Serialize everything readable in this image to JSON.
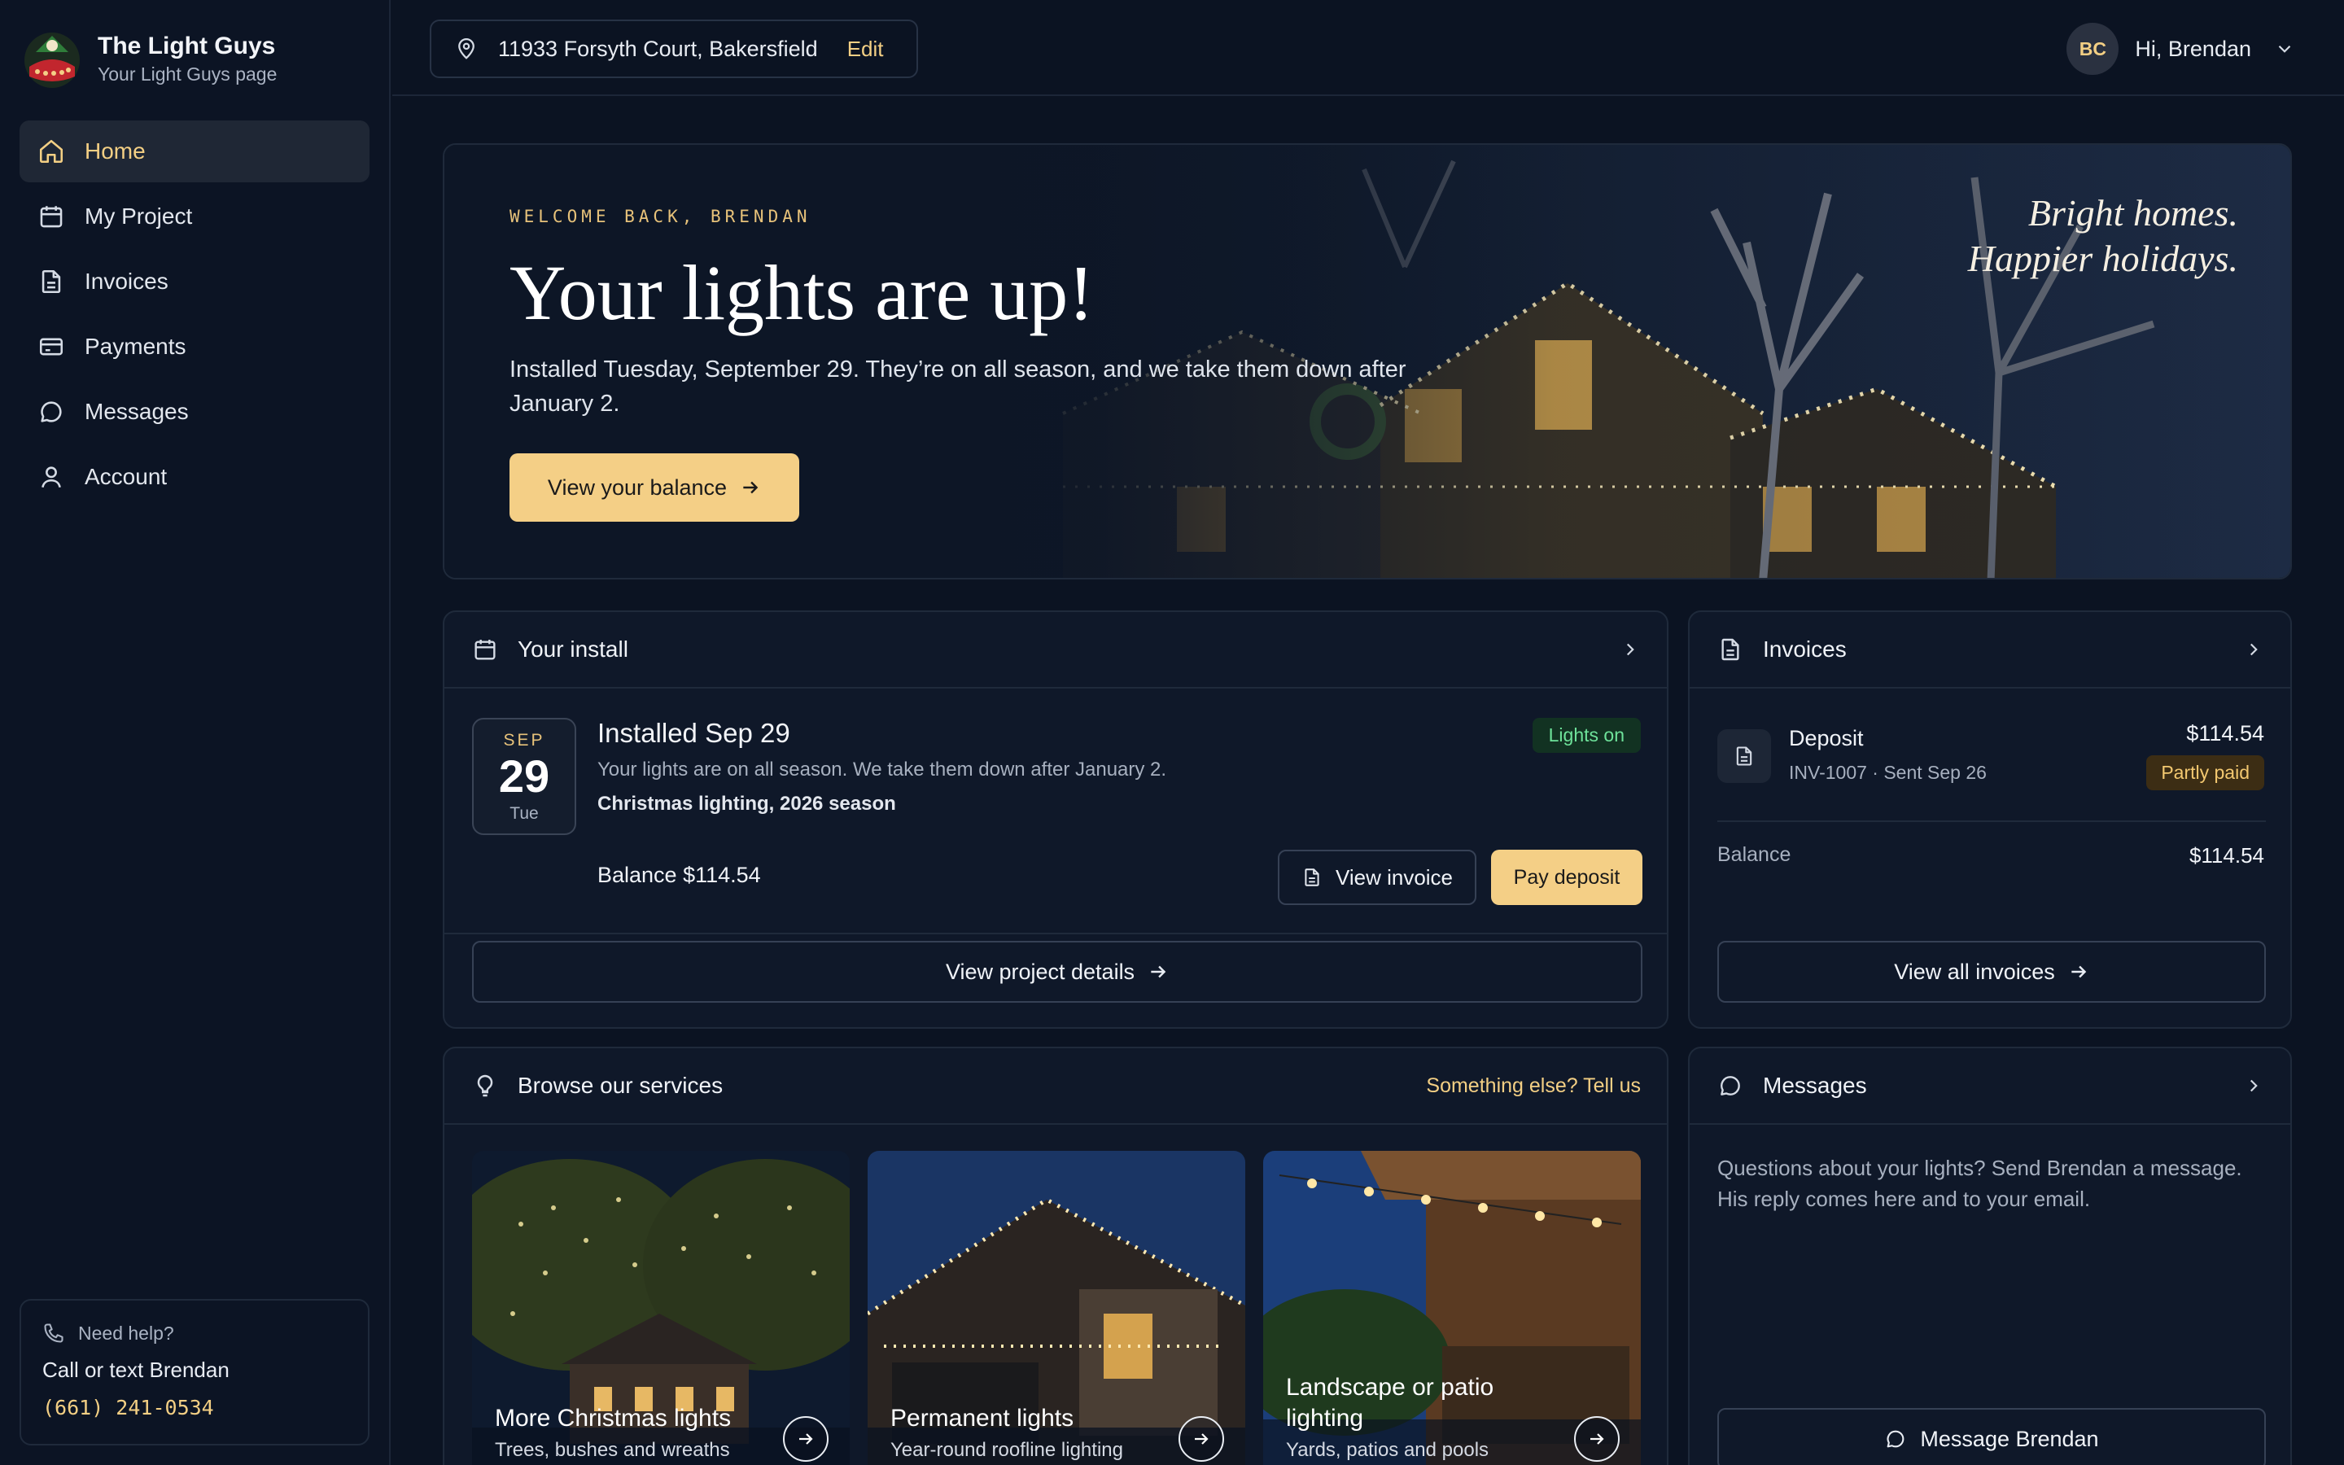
{
  "brand": {
    "name": "The Light Guys",
    "subtitle": "Your Light Guys page"
  },
  "nav": [
    {
      "label": "Home",
      "icon": "home-icon",
      "active": true
    },
    {
      "label": "My Project",
      "icon": "calendar-icon"
    },
    {
      "label": "Invoices",
      "icon": "document-icon"
    },
    {
      "label": "Payments",
      "icon": "credit-card-icon"
    },
    {
      "label": "Messages",
      "icon": "chat-bubble-icon"
    },
    {
      "label": "Account",
      "icon": "user-icon"
    }
  ],
  "help": {
    "label": "Need help?",
    "call": "Call or text Brendan",
    "phone": "(661) 241-0534"
  },
  "topbar": {
    "address": "11933 Forsyth Court, Bakersfield",
    "edit_label": "Edit",
    "user_initials": "BC",
    "user_greeting": "Hi, Brendan"
  },
  "hero": {
    "eyebrow": "WELCOME BACK, BRENDAN",
    "title": "Your lights are up!",
    "description": "Installed Tuesday, September 29. They’re on all season, and we take them down after January 2.",
    "button_label": "View your balance",
    "tagline_line1": "Bright homes.",
    "tagline_line2": "Happier holidays."
  },
  "install": {
    "title": "Your install",
    "date_month": "SEP",
    "date_day": "29",
    "date_weekday": "Tue",
    "heading": "Installed Sep 29",
    "note": "Your lights are on all season. We take them down after January 2.",
    "season": "Christmas lighting, 2026 season",
    "status_badge": "Lights on",
    "balance": "Balance $114.54",
    "view_invoice_label": "View invoice",
    "pay_deposit_label": "Pay deposit",
    "project_details_label": "View project details"
  },
  "invoices": {
    "title": "Invoices",
    "item_name": "Deposit",
    "item_meta": "INV-1007 · Sent Sep 26",
    "item_amount": "$114.54",
    "item_status": "Partly paid",
    "balance_label": "Balance",
    "balance_amount": "$114.54",
    "view_all_label": "View all invoices"
  },
  "services": {
    "title": "Browse our services",
    "link": "Something else? Tell us",
    "tiles": [
      {
        "title": "More Christmas lights",
        "subtitle": "Trees, bushes and wreaths"
      },
      {
        "title": "Permanent lights",
        "subtitle": "Year-round roofline lighting"
      },
      {
        "title": "Landscape or patio lighting",
        "subtitle": "Yards, patios and pools"
      }
    ]
  },
  "messages": {
    "title": "Messages",
    "body": "Questions about your lights? Send Brendan a message. His reply comes here and to your email.",
    "button_label": "Message Brendan"
  },
  "colors": {
    "accent": "#f4cf86",
    "background": "#0b1322",
    "card": "#0f1829",
    "success": "#6ee29a"
  }
}
